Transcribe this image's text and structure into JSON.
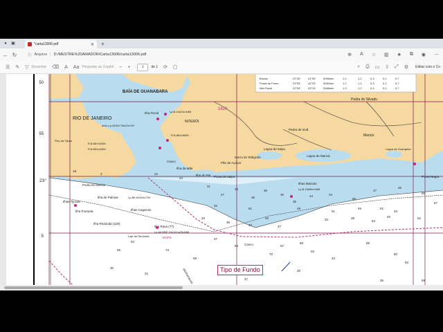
{
  "browser": {
    "tab_title": "*carta13006.pdf",
    "address_label": "Arquivo",
    "address_url": "D:/MESTRE%20AMADOR/Carta13006/carta13006.pdf"
  },
  "pdf_toolbar": {
    "draw_label": "Desenhar",
    "copilot_label": "Perguntar ao Copilot",
    "page_current": "1",
    "page_total": "de 1",
    "copilot_right": "Editar com o Co"
  },
  "chart_text": {
    "bay": "BAÍA DE GUANABARA",
    "city": "RIO DE JANEIRO",
    "niteroi": "NITERÓI",
    "lat_50": "50",
    "lat_55": "55",
    "lat_23": "23°",
    "lat_5": "5",
    "ilha_fiscal": "Ilha Fiscal",
    "lp_fiscal": "Lp.B.10s21m18M",
    "aero": "Aero Lp.Alt.BV.75s22m7M",
    "rb1": "R.B.667m24M",
    "rb2": "R.B.651m40M",
    "rb3": "R.B.881m50M",
    "pico_tijuca": "Pico da Tijuca",
    "cascos": "Casco",
    "pedra_silvado": "Pedra do Silvado",
    "pedra_inoa": "Pedra de Inoã",
    "ilha_pai": "Ilha do Pai",
    "ilha_mae": "Ilha da Mãe",
    "ponta_itaipu": "Ponta de Itaipu",
    "ponta_marica": "Ponta do Maricá",
    "ilhas_marica": "Ilhas Maricás",
    "lp_marica": "Lp.B.15s80m16M",
    "lagoa_marica": "Lagoa de Maricá",
    "marica": "Maricá",
    "lagoa_itaipu": "Lagoa de Itaipu",
    "morro_telegrafo": "Morro do Telégrafo",
    "pao_acucar": "Pão de Açúcar",
    "ilha_palmas": "Ilha de Palmas",
    "ilhas_tijucas": "Ilhas Tijucas",
    "ilha_pontuda": "Ilha Pontuda",
    "ilha_redonda": "Ilha Redonda (228)",
    "ilha_rasa": "Ilha Rasa (77)",
    "lp_rasa": "Lp.Alt.BBE.15s161m25/45M",
    "ilhas_cagarras": "Ilhas Cagarras",
    "lp_cagarras": "Lp.BE.6s32m17M",
    "laje_redonda": "Laje de Redonda",
    "dgps": "DGPS",
    "depth_1620": "1620",
    "tipo_fundo": "Tipo de Fundo",
    "casco": "Casco",
    "alinhamento": "Alinhamento",
    "lagoa_guarapina": "Lagoa de Guarapina",
    "ponta_negra": "Ponta Negra"
  },
  "tide_table": {
    "rows": [
      [
        "Búzios",
        "22°45'",
        "41°53'",
        "2h56min",
        "1,2",
        "1,2",
        "0,3",
        "0,1",
        "0,7"
      ],
      [
        "Ponta do Forno",
        "23°05'",
        "42°03'",
        "2h50min",
        "1,2",
        "1,1",
        "0,3",
        "0,1",
        "0,7"
      ],
      [
        "Ilha Fiscal",
        "22°54'",
        "43°10'",
        "2h58min",
        "1,3",
        "1,2",
        "0,4",
        "0,1",
        "0,7"
      ]
    ]
  },
  "soundings": [
    "18",
    "3",
    "22",
    "24",
    "21",
    "27",
    "25",
    "35",
    "36",
    "45",
    "35",
    "44",
    "34",
    "56",
    "47",
    "46",
    "60",
    "61",
    "40",
    "48",
    "51",
    "45",
    "51",
    "33",
    "32",
    "34",
    "36",
    "42",
    "47",
    "32",
    "38",
    "53",
    "40",
    "62",
    "57",
    "56",
    "62",
    "73",
    "58",
    "37",
    "64",
    "52",
    "43",
    "59",
    "50",
    "53",
    "70",
    "30",
    "47",
    "59",
    "35",
    "30",
    "21",
    "57",
    "58"
  ],
  "colors": {
    "land": "#f6d9a0",
    "shallow": "#b9ddef",
    "medium": "#dff0f8",
    "deep": "#ffffff",
    "accent": "#c0267c"
  }
}
